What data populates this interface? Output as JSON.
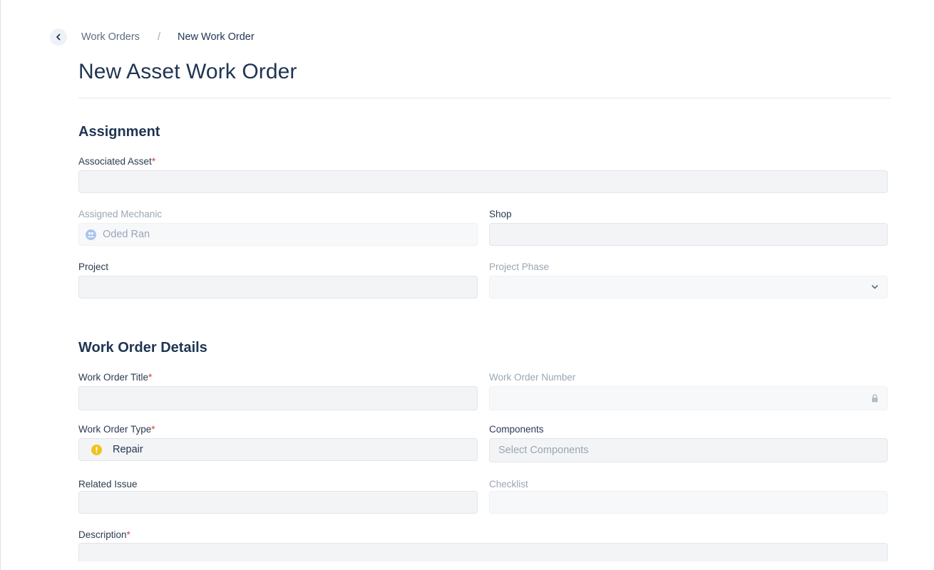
{
  "breadcrumb": {
    "parent": "Work Orders",
    "separator": "/",
    "current": "New Work Order"
  },
  "page_title": "New Asset Work Order",
  "assignment": {
    "title": "Assignment",
    "associated_asset_label": "Associated Asset",
    "required_mark": "*",
    "assigned_mechanic_label": "Assigned Mechanic",
    "assigned_mechanic_value": "Oded Ran",
    "shop_label": "Shop",
    "project_label": "Project",
    "project_phase_label": "Project Phase"
  },
  "details": {
    "title": "Work Order Details",
    "wo_title_label": "Work Order Title",
    "wo_number_label": "Work Order Number",
    "wo_type_label": "Work Order Type",
    "wo_type_value": "Repair",
    "components_label": "Components",
    "components_placeholder": "Select Components",
    "related_issue_label": "Related Issue",
    "checklist_label": "Checklist",
    "description_label": "Description"
  },
  "colors": {
    "required": "#e0383e",
    "repair_badge": "#f2c21b",
    "mechanic_icon": "#a9c4ec"
  },
  "icons": {
    "back": "chevron-left-icon",
    "mechanic": "people-icon",
    "phase": "chevron-down-icon",
    "number": "lock-icon",
    "type": "exclamation-icon"
  }
}
